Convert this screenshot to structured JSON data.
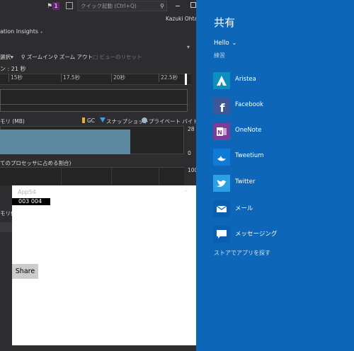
{
  "vs": {
    "notification_count": "1",
    "quick_launch_placeholder": "クイック起動 (Ctrl+Q)",
    "user_name": "Kazuki Ohta",
    "tab_title": "ation Insights",
    "toolbar": {
      "select": "選択▾",
      "zoom_in": "ズームイン",
      "zoom_out": "ズーム アウト",
      "reset_view": "ビューのリセット"
    },
    "duration_label": "ン : 21 秒",
    "timeline_ticks": [
      "15秒",
      "17.5秒",
      "20秒",
      "22.5秒"
    ],
    "memory_title": "モリ (MB)",
    "legend": {
      "gc": "GC",
      "snapshot": "スナップショット",
      "private": "プライベート バイト"
    },
    "memory_axis_top": "28",
    "memory_axis_bottom": "0",
    "cpu_title": "てのプロセッサに占める割合)",
    "cpu_axis_top": "100",
    "partial_label": "モリ使"
  },
  "app": {
    "title": "App54",
    "counter": "003  004",
    "share_button": "Share"
  },
  "charm": {
    "title": "共有",
    "source": "Hello",
    "subtitle": "練習",
    "items": [
      {
        "label": "Aristea",
        "icon": "aristea-icon",
        "color": "#0b8fbf"
      },
      {
        "label": "Facebook",
        "icon": "facebook-icon",
        "color": "#3b5998"
      },
      {
        "label": "OneNote",
        "icon": "onenote-icon",
        "color": "#7d3c98"
      },
      {
        "label": "Tweetium",
        "icon": "tweetium-icon",
        "color": "#0f7bd6"
      },
      {
        "label": "Twitter",
        "icon": "twitter-icon",
        "color": "#2aa1e6"
      },
      {
        "label": "メール",
        "icon": "mail-icon",
        "color": "#0a5fb0"
      },
      {
        "label": "メッセージング",
        "icon": "messaging-icon",
        "color": "#0a5fb0"
      }
    ],
    "store_link": "ストアでアプリを探す"
  },
  "colors": {
    "charm_bg": "#0d66b8",
    "vs_bg": "#2d2d30",
    "memory_area": "#5d8aa0"
  }
}
